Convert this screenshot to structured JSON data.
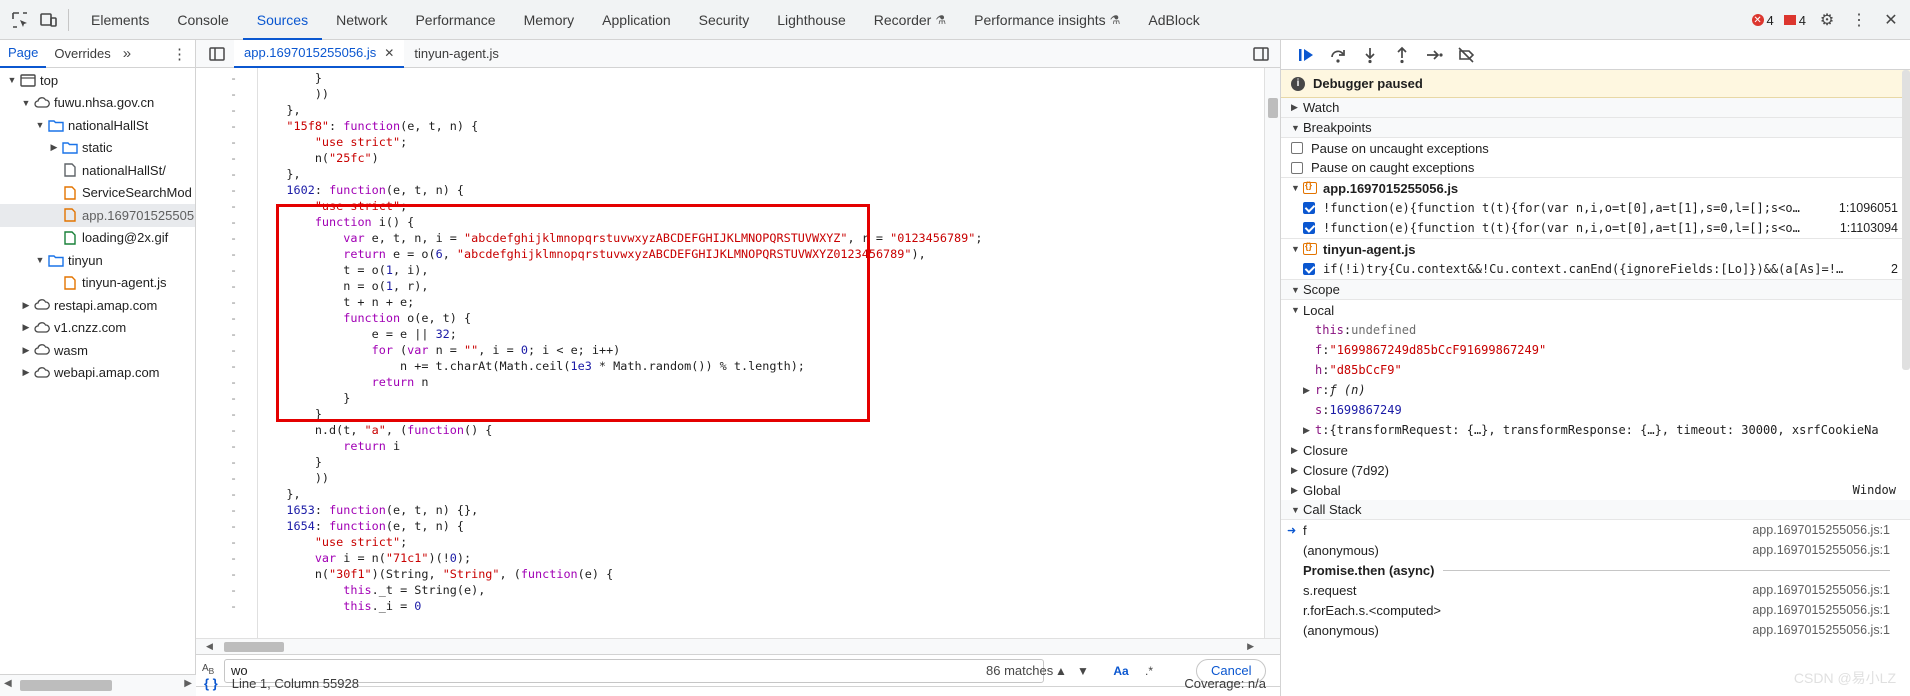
{
  "top_tabs": [
    "Elements",
    "Console",
    "Sources",
    "Network",
    "Performance",
    "Memory",
    "Application",
    "Security",
    "Lighthouse",
    "Recorder",
    "Performance insights",
    "AdBlock"
  ],
  "top_tabs_with_flask": [
    "Recorder",
    "Performance insights"
  ],
  "active_top_tab": "Sources",
  "top_right": {
    "errors": "4",
    "warnings": "4"
  },
  "left_panel": {
    "tabs": [
      "Page",
      "Overrides"
    ],
    "more": "»",
    "tree": [
      {
        "label": "top",
        "depth": 0,
        "type": "frame",
        "open": true
      },
      {
        "label": "fuwu.nhsa.gov.cn",
        "depth": 1,
        "type": "cloud",
        "open": true
      },
      {
        "label": "nationalHallSt",
        "depth": 2,
        "type": "folder",
        "open": true
      },
      {
        "label": "static",
        "depth": 3,
        "type": "folder",
        "open": false
      },
      {
        "label": "nationalHallSt/",
        "depth": 3,
        "type": "file"
      },
      {
        "label": "ServiceSearchMod",
        "depth": 3,
        "type": "file-js"
      },
      {
        "label": "app.169701525505",
        "depth": 3,
        "type": "file-js",
        "selected": true
      },
      {
        "label": "loading@2x.gif",
        "depth": 3,
        "type": "file-img"
      },
      {
        "label": "tinyun",
        "depth": 2,
        "type": "folder",
        "open": true
      },
      {
        "label": "tinyun-agent.js",
        "depth": 3,
        "type": "file-js"
      },
      {
        "label": "restapi.amap.com",
        "depth": 1,
        "type": "cloud",
        "open": false
      },
      {
        "label": "v1.cnzz.com",
        "depth": 1,
        "type": "cloud",
        "open": false
      },
      {
        "label": "wasm",
        "depth": 1,
        "type": "cloud",
        "open": false
      },
      {
        "label": "webapi.amap.com",
        "depth": 1,
        "type": "cloud",
        "open": false
      }
    ]
  },
  "editor": {
    "tabs": [
      {
        "label": "app.1697015255056.js",
        "active": true,
        "closable": true
      },
      {
        "label": "tinyun-agent.js",
        "active": false,
        "closable": false
      }
    ],
    "code_lines": [
      "        }",
      "        ))",
      "    },",
      "    \"15f8\": function(e, t, n) {",
      "        \"use strict\";",
      "        n(\"25fc\")",
      "    },",
      "    1602: function(e, t, n) {",
      "        \"use strict\";",
      "        function i() {",
      "            var e, t, n, i = \"abcdefghijklmnopqrstuvwxyzABCDEFGHIJKLMNOPQRSTUVWXYZ\", r = \"0123456789\";",
      "            return e = o(6, \"abcdefghijklmnopqrstuvwxyzABCDEFGHIJKLMNOPQRSTUVWXYZ0123456789\"),",
      "            t = o(1, i),",
      "            n = o(1, r),",
      "            t + n + e;",
      "            function o(e, t) {",
      "                e = e || 32;",
      "                for (var n = \"\", i = 0; i < e; i++)",
      "                    n += t.charAt(Math.ceil(1e3 * Math.random()) % t.length);",
      "                return n",
      "            }",
      "        }",
      "        n.d(t, \"a\", (function() {",
      "            return i",
      "        }",
      "        ))",
      "    },",
      "    1653: function(e, t, n) {},",
      "    1654: function(e, t, n) {",
      "        \"use strict\";",
      "        var i = n(\"71c1\")(!0);",
      "        n(\"30f1\")(String, \"String\", (function(e) {",
      "            this._t = String(e),",
      "            this._i = 0"
    ],
    "gutter_marker": "-",
    "find": {
      "query": "wo",
      "matches": "86 matches",
      "aa": "Aa",
      "regex": ".*",
      "cancel": "Cancel"
    },
    "status": {
      "position": "Line 1, Column 55928",
      "coverage": "Coverage: n/a"
    }
  },
  "debugger": {
    "paused": "Debugger paused",
    "watch": "Watch",
    "breakpoints": "Breakpoints",
    "pause_uncaught": "Pause on uncaught exceptions",
    "pause_caught": "Pause on caught exceptions",
    "bp_files": [
      {
        "file": "app.1697015255056.js",
        "items": [
          {
            "code": "!function(e){function t(t){for(var n,i,o=t[0],a=t[1],s=0,l=[];s<o…",
            "loc": "1:1096051"
          },
          {
            "code": "!function(e){function t(t){for(var n,i,o=t[0],a=t[1],s=0,l=[];s<o…",
            "loc": "1:1103094"
          }
        ]
      },
      {
        "file": "tinyun-agent.js",
        "items": [
          {
            "code": "if(!i)try{Cu.context&&!Cu.context.canEnd({ignoreFields:[Lo]})&&(a[As]=!…",
            "loc": "2"
          }
        ]
      }
    ],
    "scope": "Scope",
    "local": "Local",
    "vars": [
      {
        "key": "this",
        "val": "undefined",
        "kind": "undef",
        "expand": false
      },
      {
        "key": "f",
        "val": "\"1699867249d85bCcF91699867249\"",
        "kind": "str",
        "expand": false
      },
      {
        "key": "h",
        "val": "\"d85bCcF9\"",
        "kind": "str",
        "expand": false
      },
      {
        "key": "r",
        "val": "ƒ (n)",
        "kind": "fn",
        "expand": true
      },
      {
        "key": "s",
        "val": "1699867249",
        "kind": "num",
        "expand": false
      },
      {
        "key": "t",
        "val": "{transformRequest: {…}, transformResponse: {…}, timeout: 30000, xsrfCookieNa",
        "kind": "obj",
        "expand": true
      }
    ],
    "closure": "Closure",
    "closure2": "Closure (7d92)",
    "global": "Global",
    "global_val": "Window",
    "call_stack": "Call Stack",
    "frames": [
      {
        "fn": "f",
        "loc": "app.1697015255056.js:1",
        "active": true
      },
      {
        "fn": "(anonymous)",
        "loc": "app.1697015255056.js:1"
      }
    ],
    "async_label": "Promise.then (async)",
    "frames2": [
      {
        "fn": "s.request",
        "loc": "app.1697015255056.js:1"
      },
      {
        "fn": "r.forEach.s.<computed>",
        "loc": "app.1697015255056.js:1"
      },
      {
        "fn": "(anonymous)",
        "loc": "app.1697015255056.js:1"
      }
    ],
    "watermark": "CSDN @易小LZ"
  },
  "colors": {
    "accent": "#0b57d0",
    "highlight_box": "#e40000",
    "error": "#dc362e",
    "paused_bg": "#fef7e0"
  }
}
